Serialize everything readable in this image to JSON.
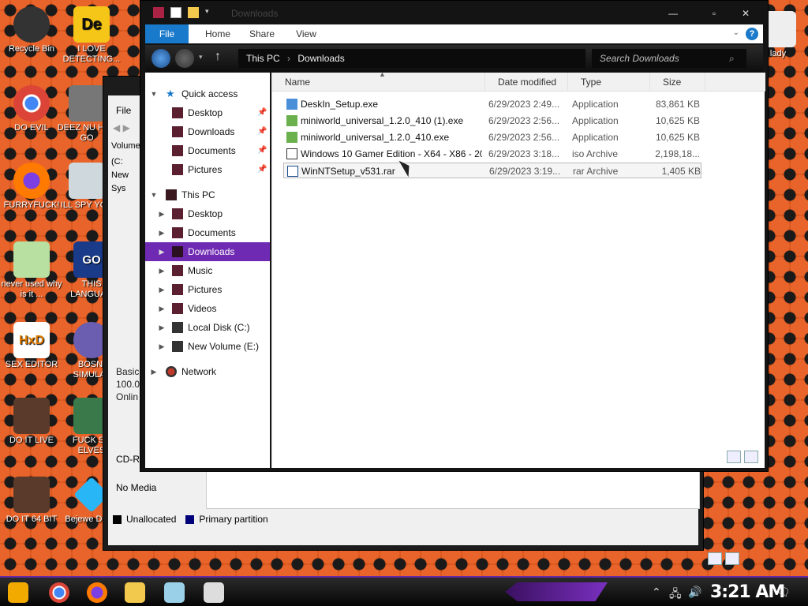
{
  "desktop_icons": [
    {
      "label": "Recycle Bin"
    },
    {
      "label": "I LOVE DETECTING..."
    },
    {
      "label": "DO EVIL"
    },
    {
      "label": "DEEZ NU HAH GO"
    },
    {
      "label": "FURRYFUCK!"
    },
    {
      "label": "ILL SPY YOU"
    },
    {
      "label": "never used why is it ..."
    },
    {
      "label": "THIS LANGUAG"
    },
    {
      "label": "SEX EDITOR"
    },
    {
      "label": "BOSNI SIMULAT"
    },
    {
      "label": "DO IT LIVE"
    },
    {
      "label": "FUCK SC ELVES"
    },
    {
      "label": "DO IT 64 BIT"
    },
    {
      "label": "Bejewe Delux"
    },
    {
      "label": "lady"
    }
  ],
  "back_window": {
    "menu_file": "File",
    "column_volume": "Volume",
    "volumes": [
      "(C:",
      "New",
      "Sys"
    ],
    "disk_info": [
      "Basic",
      "100.0",
      "Onlin"
    ],
    "cdrom_label": "CD-R",
    "cdrom_status": "No Media",
    "legend": [
      {
        "label": "Unallocated",
        "color": "#000000"
      },
      {
        "label": "Primary partition",
        "color": "#00007a"
      }
    ]
  },
  "explorer": {
    "title": "Downloads",
    "ribbon_tabs": [
      "File",
      "Home",
      "Share",
      "View"
    ],
    "address": {
      "root": "This PC",
      "current": "Downloads"
    },
    "search_placeholder": "Search Downloads",
    "nav": [
      {
        "label": "Quick access",
        "pinned": false
      },
      {
        "label": "Desktop",
        "pinned": true
      },
      {
        "label": "Downloads",
        "pinned": true
      },
      {
        "label": "Documents",
        "pinned": true
      },
      {
        "label": "Pictures",
        "pinned": true
      },
      {
        "label": "This PC",
        "pinned": false
      },
      {
        "label": "Desktop"
      },
      {
        "label": "Documents"
      },
      {
        "label": "Downloads",
        "selected": true
      },
      {
        "label": "Music"
      },
      {
        "label": "Pictures"
      },
      {
        "label": "Videos"
      },
      {
        "label": "Local Disk (C:)"
      },
      {
        "label": "New Volume (E:)"
      },
      {
        "label": "Network"
      }
    ],
    "columns": [
      "Name",
      "Date modified",
      "Type",
      "Size"
    ],
    "files": [
      {
        "name": "DeskIn_Setup.exe",
        "date": "6/29/2023 2:49...",
        "type": "Application",
        "size": "83,861 KB"
      },
      {
        "name": "miniworld_universal_1.2.0_410 (1).exe",
        "date": "6/29/2023 2:56...",
        "type": "Application",
        "size": "10,625 KB"
      },
      {
        "name": "miniworld_universal_1.2.0_410.exe",
        "date": "6/29/2023 2:56...",
        "type": "Application",
        "size": "10,625 KB"
      },
      {
        "name": "Windows 10 Gamer Edition - X64 - X86 - 201...",
        "date": "6/29/2023 3:18...",
        "type": "iso Archive",
        "size": "2,198,18..."
      },
      {
        "name": "WinNTSetup_v531.rar",
        "date": "6/29/2023 3:19...",
        "type": "rar Archive",
        "size": "1,405 KB",
        "selected": true
      }
    ]
  },
  "taskbar": {
    "clock": "3:21 AM"
  },
  "colors": {
    "accent": "#6f2ab3",
    "file_tab": "#1979ca",
    "desktop_bg": "#d4521a"
  }
}
